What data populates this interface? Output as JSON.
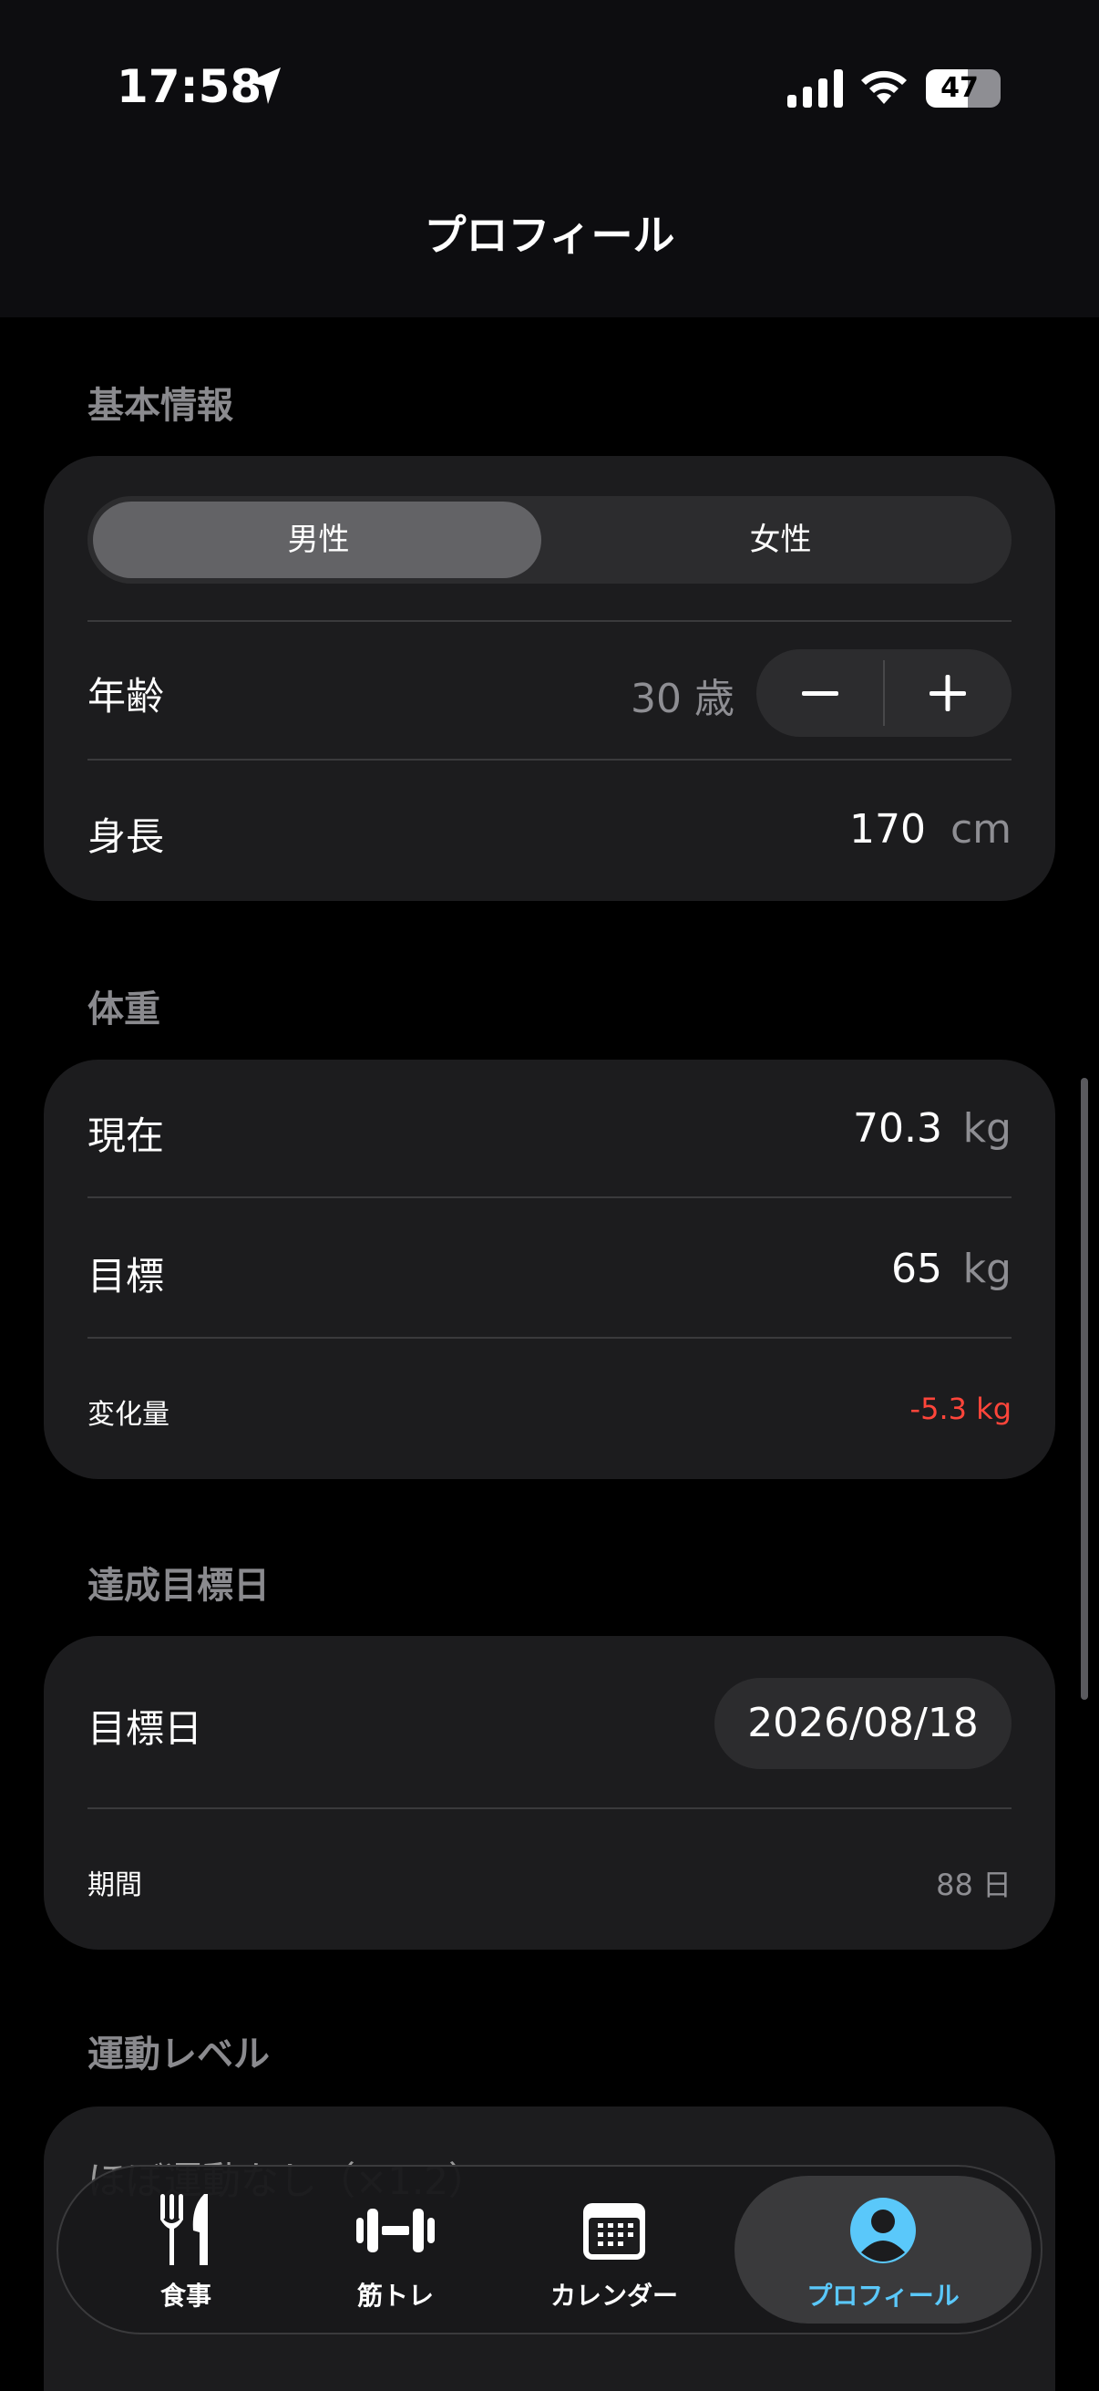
{
  "status_bar": {
    "time": "17:58",
    "battery_level": "47"
  },
  "nav": {
    "title": "プロフィール"
  },
  "basic_info": {
    "section_label": "基本情報",
    "gender_options": [
      "男性",
      "女性"
    ],
    "gender_selected": "男性",
    "age_label": "年齢",
    "age_value": "30",
    "age_unit": "歳",
    "height_label": "身長",
    "height_value": "170",
    "height_unit": "cm"
  },
  "weight": {
    "section_label": "体重",
    "current_label": "現在",
    "current_value": "70.3",
    "current_unit": "kg",
    "target_label": "目標",
    "target_value": "65",
    "target_unit": "kg",
    "change_label": "変化量",
    "change_value": "-5.3 kg",
    "change_color": "#ff453a"
  },
  "goal_date": {
    "section_label": "達成目標日",
    "date_label": "目標日",
    "date_value": "2026/08/18",
    "period_label": "期間",
    "period_value": "88 日"
  },
  "activity": {
    "section_label": "運動レベル",
    "first_option": "ほぼ運動なし（×1.2）"
  },
  "tab_bar": {
    "tabs": [
      {
        "label": "食事",
        "icon": "fork-knife-icon"
      },
      {
        "label": "筋トレ",
        "icon": "dumbbell-icon"
      },
      {
        "label": "カレンダー",
        "icon": "calendar-icon"
      },
      {
        "label": "プロフィール",
        "icon": "person-circle-icon"
      }
    ],
    "active_tab": "プロフィール",
    "active_color": "#5ac8fa"
  }
}
